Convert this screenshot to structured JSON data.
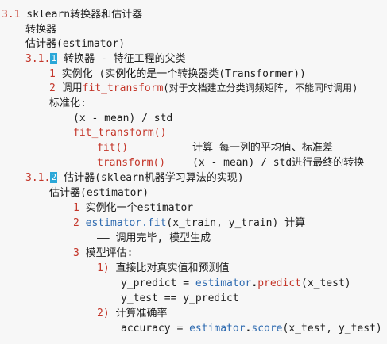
{
  "colors": {
    "number": "#c4362a",
    "code": "#c4362a",
    "method": "#2f6bb0",
    "badge": "#2aa7d8",
    "text": "#1d1d1d"
  },
  "outline": {
    "h1_num": "3.1",
    "h1_text": " sklearn转换器和估计器",
    "l_converter": "转换器",
    "l_estimator_def": "估计器(estimator)",
    "s1": {
      "num": "3.1.",
      "badge": "1",
      "text": " 转换器 - 特征工程的父类"
    },
    "s1_item1": {
      "num": "1",
      "text": " 实例化 (实例化的是一个转换器类(Transformer))"
    },
    "s1_item2": {
      "num": "2",
      "pre": " 调用",
      "code": "fit_transform",
      "post": "(对于文档建立分类词频矩阵, 不能同时调用)"
    },
    "standardize": "标准化:",
    "formula": "(x - mean) / std",
    "fit_transform": "fit_transform()",
    "fit_row": {
      "code": "fit()",
      "desc": "计算 每一列的平均值、标准差"
    },
    "transform_row": {
      "code": "transform()",
      "desc": "(x - mean) / std进行最终的转换"
    },
    "s2": {
      "num": "3.1.",
      "badge": "2",
      "text": " 估计器(sklearn机器学习算法的实现)"
    },
    "s2_title": "估计器(estimator)",
    "s2_item1": {
      "num": "1",
      "text": " 实例化一个estimator"
    },
    "s2_item2": {
      "num": "2",
      "code": " estimator.fit",
      "post": "(x_train, y_train) 计算"
    },
    "s2_item2_note": "—— 调用完毕, 模型生成",
    "s2_item3": {
      "num": "3",
      "text": " 模型评估:"
    },
    "eval1": {
      "num": "1)",
      "text": " 直接比对真实值和预测值"
    },
    "predict_line": {
      "pre": "y_predict = ",
      "obj": "estimator",
      "dot": ".",
      "method": "predict",
      "post": "(x_test)"
    },
    "compare_line": "y_test == y_predict",
    "eval2": {
      "num": "2)",
      "text": " 计算准确率"
    },
    "score_line": {
      "pre": "accuracy = ",
      "obj": "estimator",
      "dot": ".",
      "method": "score",
      "post": "(x_test, y_test)"
    }
  }
}
